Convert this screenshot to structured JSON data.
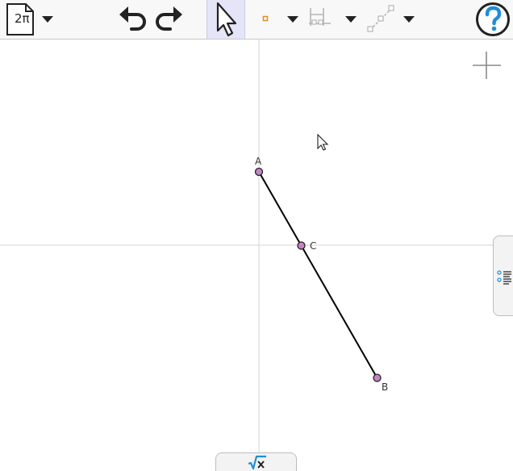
{
  "toolbar": {
    "file_button": {
      "label": "2π",
      "icon": "new-file-icon"
    },
    "file_menu": {
      "icon": "chevron-down-icon"
    },
    "undo": {
      "icon": "undo-icon"
    },
    "redo": {
      "icon": "redo-icon"
    },
    "move_tool": {
      "icon": "cursor-arrow-icon",
      "selected": true
    },
    "point_tool": {
      "icon": "point-tool-icon"
    },
    "perpendicular_tool": {
      "icon": "perpendicular-tool-icon"
    },
    "line_tool": {
      "icon": "line-tool-icon"
    },
    "help": {
      "icon": "help-icon"
    },
    "colors": {
      "dark": "#222222",
      "selected_bg": "#e4e6f7",
      "point_orange": "#e08c1b",
      "help_blue": "#1f8ed7",
      "disabled_gray": "#b5b5b5"
    }
  },
  "graphics": {
    "zoom_control": {
      "icon": "plus-icon"
    },
    "points": [
      {
        "label": "A",
        "fill": "#c285c2"
      },
      {
        "label": "C",
        "fill": "#c285c2"
      },
      {
        "label": "B",
        "fill": "#c285c2"
      }
    ],
    "segment": {
      "from": "A",
      "to": "B",
      "color": "#000000"
    },
    "axes": {
      "visible": true,
      "color": "#d6d6d6"
    }
  },
  "side_panel_tab": {
    "icon": "algebra-view-icon"
  },
  "bottom_tab": {
    "icon": "input-bar-sqrt-icon",
    "accent": "#1f8ed7"
  }
}
